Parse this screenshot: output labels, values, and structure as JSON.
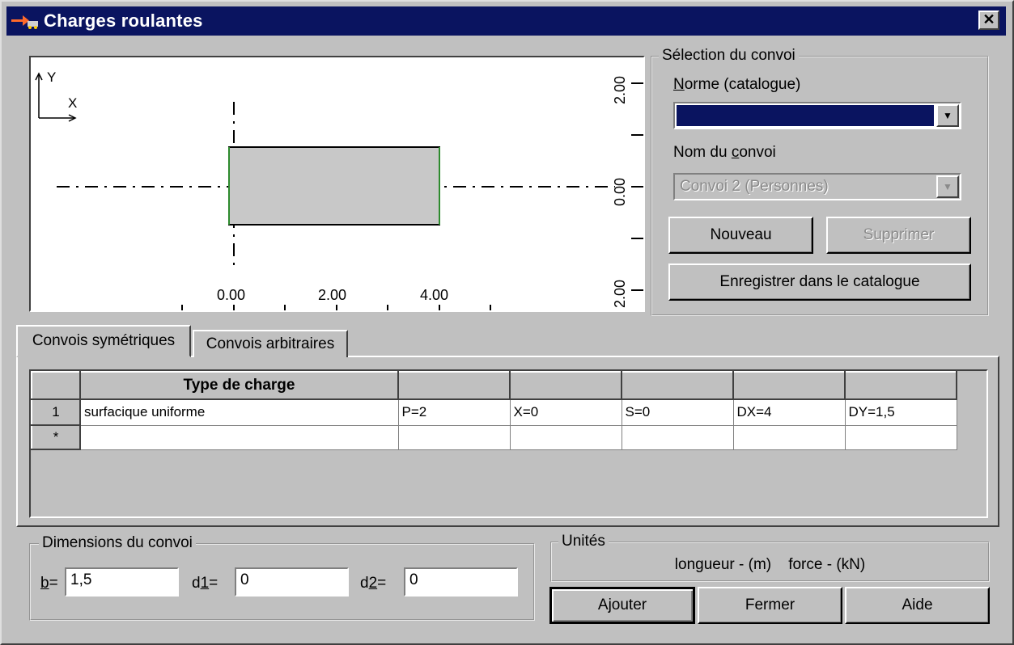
{
  "window": {
    "title": "Charges roulantes",
    "close_label": "✕"
  },
  "preview": {
    "axis_y": "Y",
    "axis_x": "X",
    "x_ticks": [
      "0.00",
      "2.00",
      "4.00"
    ],
    "y_ticks": [
      "2.00",
      "0.00",
      "2.00"
    ]
  },
  "selection": {
    "group_label": "Sélection du convoi",
    "norme_label_prefix": "N",
    "norme_label_rest": "orme (catalogue)",
    "norme_value": "",
    "nom_label_prefix": "Nom du ",
    "nom_label_ul": "c",
    "nom_label_rest": "onvoi",
    "nom_value": "Convoi 2 (Personnes)",
    "nouveau_label": "Nouveau",
    "supprimer_label": "Supprimer",
    "enregistrer_label": "Enregistrer dans le catalogue"
  },
  "tabs": {
    "symetriques": "Convois symétriques",
    "arbitraires": "Convois arbitraires"
  },
  "grid": {
    "header": [
      "",
      "Type de charge",
      "",
      "",
      "",
      "",
      ""
    ],
    "rows": [
      [
        "1",
        "surfacique uniforme",
        "P=2",
        "X=0",
        "S=0",
        "DX=4",
        "DY=1,5"
      ],
      [
        "*",
        "",
        "",
        "",
        "",
        "",
        ""
      ]
    ]
  },
  "dimensions": {
    "group_label": "Dimensions du convoi",
    "b_label_ul": "b",
    "b_label_rest": "=",
    "b_value": "1,5",
    "d1_label_pre": "d",
    "d1_label_ul": "1",
    "d1_label_rest": "=",
    "d1_value": "0",
    "d2_label_pre": "d",
    "d2_label_ul": "2",
    "d2_label_rest": "=",
    "d2_value": "0"
  },
  "units": {
    "group_label": "Unités",
    "text": "longueur - (m)    force - (kN)"
  },
  "buttons": {
    "ajouter": "Ajouter",
    "fermer": "Fermer",
    "aide": "Aide"
  },
  "colors": {
    "titlebar": "#0a1460",
    "selected_combo": "#0a1460",
    "load_fill": "#c8c8c8",
    "load_edge": "#2e8b2e"
  }
}
